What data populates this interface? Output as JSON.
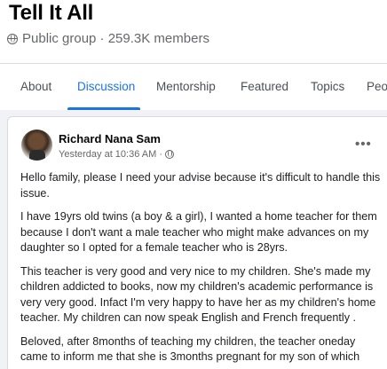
{
  "group": {
    "name": "Tell It All",
    "meta": "Public group · 259.3K members"
  },
  "tabs": [
    {
      "label": "About"
    },
    {
      "label": "Discussion",
      "active": true
    },
    {
      "label": "Mentorship"
    },
    {
      "label": "Featured"
    },
    {
      "label": "Topics"
    },
    {
      "label": "Peo"
    }
  ],
  "post": {
    "author": "Richard Nana Sam",
    "timestamp": "Yesterday at 10:36 AM ·",
    "more_label": "•••",
    "paragraphs": [
      "Hello family, please I need your advise because it's difficult to handle this issue.",
      "I have 19yrs old twins (a boy & a girl), I wanted a home teacher for them because I don't want a male teacher who might make advances on my daughter so I opted for a female teacher who is 28yrs.",
      "This teacher is very good and very nice to my children. She's made my children addicted to books, now my children's academic performance is very very good. Infact I'm very happy to have her as my children's home teacher. My children can now speak English and French frequently .",
      "Beloved, after 8months of teaching my children, the teacher oneday came to inform me that she is 3months pregnant for my son of which"
    ]
  },
  "colors": {
    "accent": "#1b74e4",
    "secondary_text": "#65676b",
    "feed_background": "#f0f2f5"
  },
  "icons": {
    "privacy": "globe-icon",
    "post_privacy": "globe-icon",
    "more": "more-options-icon"
  }
}
